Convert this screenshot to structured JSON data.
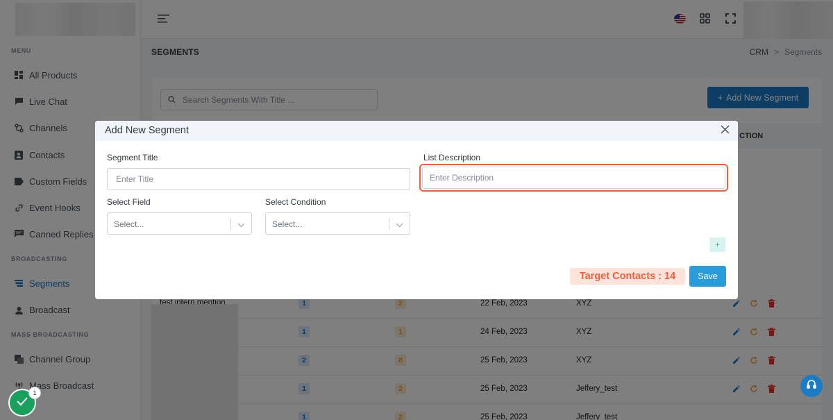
{
  "sidebar": {
    "menu_title": "MENU",
    "broadcasting_title": "BROADCASTING",
    "mass_title": "MASS BROADCASTING",
    "items": [
      {
        "label": "All Products",
        "icon": "grid-icon"
      },
      {
        "label": "Live Chat",
        "icon": "chat-icon"
      },
      {
        "label": "Channels",
        "icon": "channels-icon"
      },
      {
        "label": "Contacts",
        "icon": "contacts-icon"
      },
      {
        "label": "Custom Fields",
        "icon": "tag-icon"
      },
      {
        "label": "Event Hooks",
        "icon": "link-icon"
      },
      {
        "label": "Canned Replies",
        "icon": "message-icon"
      },
      {
        "label": "Segments",
        "icon": "segments-icon"
      },
      {
        "label": "Broadcast",
        "icon": "broadcast-icon"
      },
      {
        "label": "Channel Group",
        "icon": "channel-group-icon"
      },
      {
        "label": "Mass Broadcast",
        "icon": "antenna-icon"
      }
    ]
  },
  "page": {
    "title": "SEGMENTS",
    "breadcrumb_root": "CRM",
    "breadcrumb_sep": ">",
    "breadcrumb_current": "Segments"
  },
  "toolbar": {
    "search_placeholder": "Search Segments With Title ...",
    "add_label": "Add New Segment",
    "add_plus": "+"
  },
  "table": {
    "action_header": "CTION",
    "rows": [
      {
        "name": "test intern mention",
        "a": "1",
        "b": "2",
        "date": "22 Feb, 2023",
        "owner": "XYZ"
      },
      {
        "name": "",
        "a": "1",
        "b": "1",
        "date": "24 Feb, 2023",
        "owner": "XYZ"
      },
      {
        "name": "",
        "a": "2",
        "b": "8",
        "date": "25 Feb, 2023",
        "owner": "XYZ"
      },
      {
        "name": "",
        "a": "1",
        "b": "2",
        "date": "25 Feb, 2023",
        "owner": "Jeffery_test"
      },
      {
        "name": "",
        "a": "1",
        "b": "2",
        "date": "25 Feb, 2023",
        "owner": "Jeffery_test"
      }
    ]
  },
  "modal": {
    "title": "Add New Segment",
    "segment_title_label": "Segment Title",
    "segment_title_placeholder": "Enter Title",
    "list_desc_label": "List Description",
    "list_desc_placeholder": "Enter Description",
    "select_field_label": "Select Field",
    "select_field_placeholder": "Select...",
    "select_condition_label": "Select Condition",
    "select_condition_placeholder": "Select...",
    "plus_label": "+",
    "target_contacts": "Target Contacts : 14",
    "save_label": "Save"
  },
  "widgets": {
    "notification_count": "1"
  },
  "colors": {
    "primary": "#1b7bc4",
    "save": "#299cdb",
    "accent_orange": "#f0603a",
    "success": "#18a05c"
  }
}
